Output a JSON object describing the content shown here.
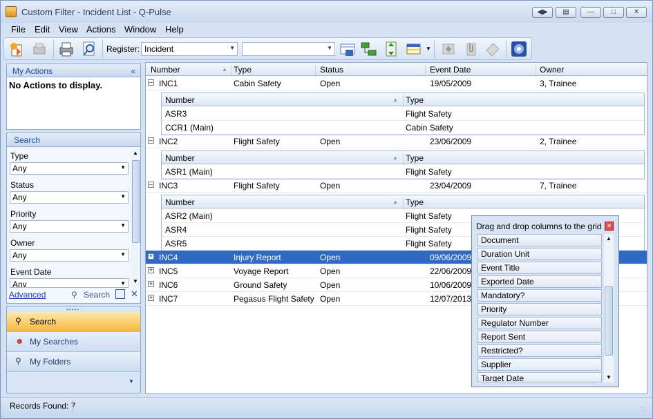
{
  "window": {
    "title": "Custom Filter - Incident List - Q-Pulse"
  },
  "menu": [
    "File",
    "Edit",
    "View",
    "Actions",
    "Window",
    "Help"
  ],
  "toolbar": {
    "register_label": "Register:",
    "register_value": "Incident",
    "filter_value": ""
  },
  "my_actions": {
    "title": "My Actions",
    "empty_text": "No Actions to display."
  },
  "search": {
    "title": "Search",
    "fields": [
      {
        "label": "Type",
        "value": "Any"
      },
      {
        "label": "Status",
        "value": "Any"
      },
      {
        "label": "Priority",
        "value": "Any"
      },
      {
        "label": "Owner",
        "value": "Any"
      },
      {
        "label": "Event Date",
        "value": "Any"
      }
    ],
    "advanced_label": "Advanced",
    "search_label": "Search"
  },
  "nav": [
    {
      "label": "Search"
    },
    {
      "label": "My Searches"
    },
    {
      "label": "My Folders"
    }
  ],
  "grid": {
    "columns": [
      "Number",
      "Type",
      "Status",
      "Event Date",
      "Owner"
    ],
    "child_columns": [
      "Number",
      "Type"
    ],
    "rows": [
      {
        "number": "INC1",
        "type": "Cabin Safety",
        "status": "Open",
        "date": "19/05/2009",
        "owner": "3, Trainee",
        "children": [
          {
            "number": "ASR3",
            "type": "Flight Safety"
          },
          {
            "number": "CCR1 (Main)",
            "type": "Cabin Safety"
          }
        ]
      },
      {
        "number": "INC2",
        "type": "Flight Safety",
        "status": "Open",
        "date": "23/06/2009",
        "owner": "2, Trainee",
        "children": [
          {
            "number": "ASR1 (Main)",
            "type": "Flight Safety"
          }
        ]
      },
      {
        "number": "INC3",
        "type": "Flight Safety",
        "status": "Open",
        "date": "23/04/2009",
        "owner": "7, Trainee",
        "children": [
          {
            "number": "ASR2 (Main)",
            "type": "Flight Safety"
          },
          {
            "number": "ASR4",
            "type": "Flight Safety"
          },
          {
            "number": "ASR5",
            "type": "Flight Safety"
          }
        ]
      },
      {
        "number": "INC4",
        "type": "Injury Report",
        "status": "Open",
        "date": "09/06/2009",
        "owner": ""
      },
      {
        "number": "INC5",
        "type": "Voyage Report",
        "status": "Open",
        "date": "22/06/2009",
        "owner": ""
      },
      {
        "number": "INC6",
        "type": "Ground Safety",
        "status": "Open",
        "date": "10/06/2009",
        "owner": ""
      },
      {
        "number": "INC7",
        "type": "Pegasus Flight Safety",
        "status": "Open",
        "date": "12/07/2013",
        "owner": ""
      }
    ]
  },
  "column_chooser": {
    "title": "Drag and drop columns to the grid",
    "items": [
      "Document",
      "Duration Unit",
      "Event Title",
      "Exported Date",
      "Mandatory?",
      "Priority",
      "Regulator Number",
      "Report Sent",
      "Restricted?",
      "Supplier",
      "Target Date"
    ]
  },
  "status": {
    "records": "Records Found: 7"
  }
}
